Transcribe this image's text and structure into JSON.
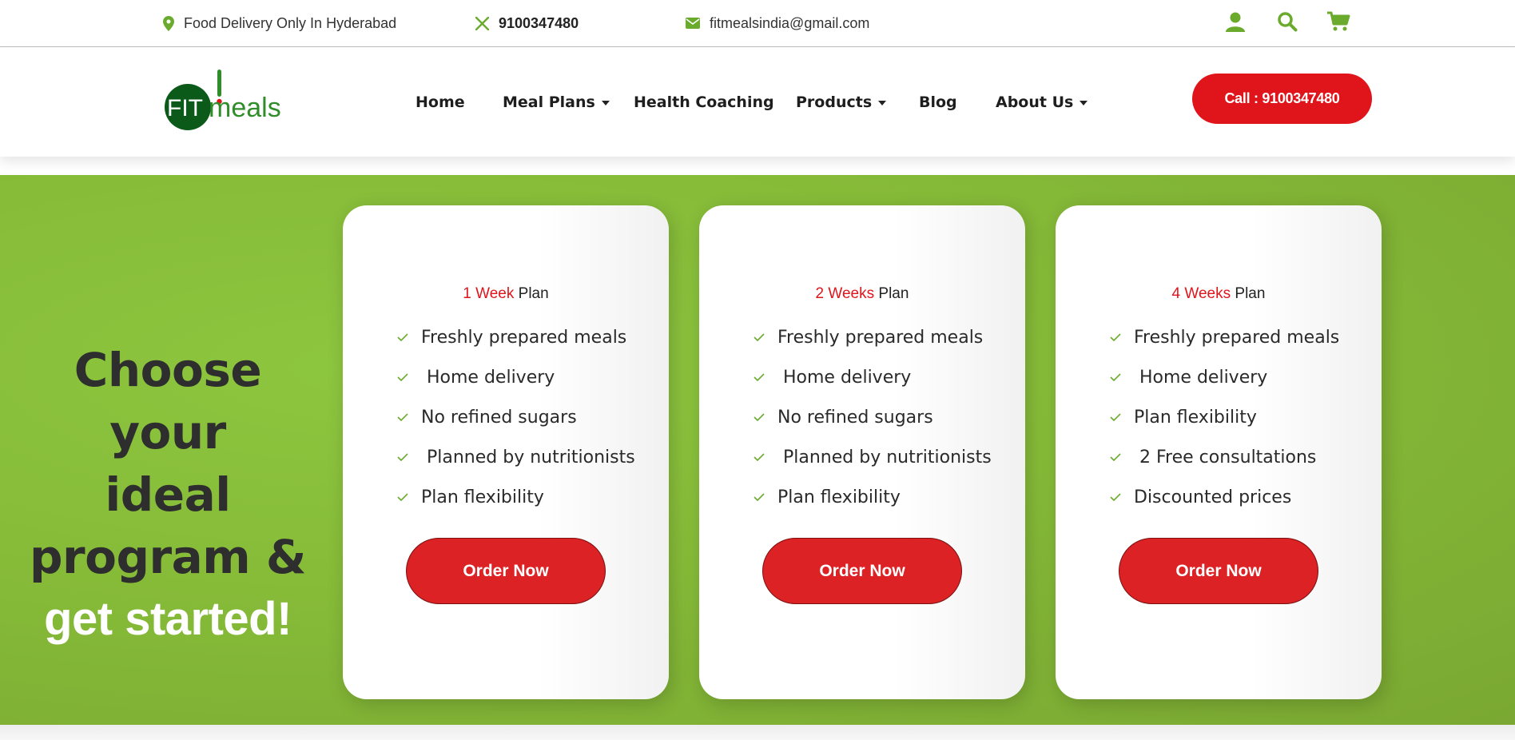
{
  "topbar": {
    "location_icon": "map-pin-icon",
    "location": "Food Delivery Only In Hyderabad",
    "phone_icon": "x-icon",
    "phone": "9100347480",
    "email_icon": "envelope-icon",
    "email": "fitmealsindia@gmail.com",
    "icons": [
      "user-icon",
      "search-icon",
      "cart-icon"
    ]
  },
  "header": {
    "logo_text_fit": "FIT",
    "logo_text_meals": "meals",
    "nav": [
      {
        "label": "Home",
        "dropdown": false
      },
      {
        "label": "Meal Plans",
        "dropdown": true
      },
      {
        "label": "Health Coaching",
        "dropdown": false
      },
      {
        "label": "Products",
        "dropdown": true
      },
      {
        "label": "Blog",
        "dropdown": false
      },
      {
        "label": "About Us",
        "dropdown": true
      }
    ],
    "call_label": "Call : 9100347480"
  },
  "hero": {
    "line1": "Choose your",
    "line2": "ideal",
    "line3": "program &",
    "line4": "get started!"
  },
  "plans": [
    {
      "duration": "1 Week",
      "suffix": " Plan",
      "features": [
        "Freshly prepared meals",
        " Home delivery",
        "No refined sugars",
        " Planned by nutritionists",
        "Plan flexibility"
      ],
      "button": "Order Now"
    },
    {
      "duration": "2 Weeks",
      "suffix": " Plan",
      "features": [
        "Freshly prepared meals",
        " Home delivery",
        "No refined sugars",
        " Planned by nutritionists",
        "Plan flexibility"
      ],
      "button": "Order Now"
    },
    {
      "duration": "4 Weeks",
      "suffix": " Plan",
      "features": [
        "Freshly prepared meals",
        " Home delivery",
        "Plan flexibility",
        " 2 Free consultations",
        "Discounted prices"
      ],
      "button": "Order Now"
    }
  ],
  "colors": {
    "brand_green": "#8dc63f",
    "accent_red": "#e0151b",
    "logo_dark_green": "#0b5a1a"
  }
}
